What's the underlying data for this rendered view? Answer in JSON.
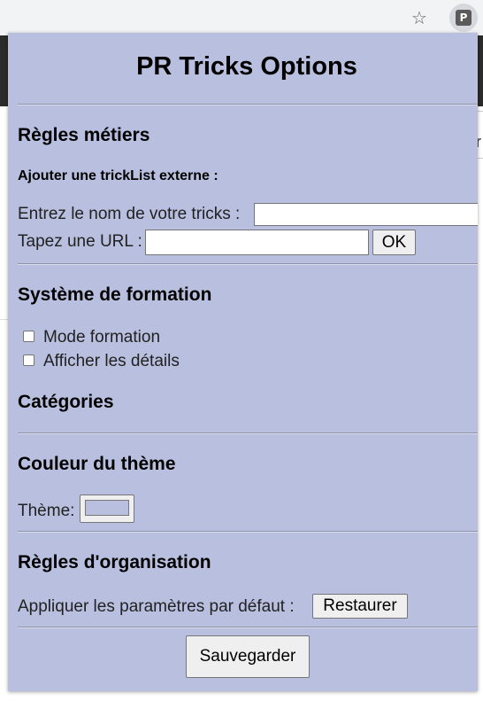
{
  "browser": {
    "star_icon": "☆",
    "extension_icon_letter": "P",
    "page_fragment": "r"
  },
  "popup": {
    "title": "PR Tricks Options",
    "background": "#b9bfdf",
    "business_rules": {
      "heading": "Règles métiers",
      "subheading": "Ajouter une trickList externe :",
      "name_label": "Entrez le nom de votre tricks :",
      "name_value": "",
      "url_label": "Tapez une URL :",
      "url_value": "",
      "ok_label": "OK"
    },
    "training": {
      "heading": "Système de formation",
      "options": [
        {
          "label": "Mode formation",
          "checked": false
        },
        {
          "label": "Afficher les détails",
          "checked": false
        }
      ]
    },
    "categories": {
      "heading": "Catégories"
    },
    "theme": {
      "heading": "Couleur du thème",
      "label": "Thème:",
      "color": "#b9bfdf"
    },
    "organization": {
      "heading": "Règles d'organisation",
      "label": "Appliquer les paramètres par défaut :",
      "restore_label": "Restaurer"
    },
    "save_label": "Sauvegarder"
  }
}
